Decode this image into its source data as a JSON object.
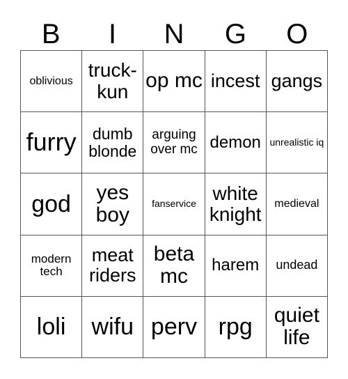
{
  "header": [
    "B",
    "I",
    "N",
    "G",
    "O"
  ],
  "cells": [
    {
      "text": "oblivious",
      "size": 16
    },
    {
      "text": "truck-kun",
      "size": 28
    },
    {
      "text": "op mc",
      "size": 30
    },
    {
      "text": "incest",
      "size": 27
    },
    {
      "text": "gangs",
      "size": 27
    },
    {
      "text": "furry",
      "size": 36
    },
    {
      "text": "dumb blonde",
      "size": 23
    },
    {
      "text": "arguing over mc",
      "size": 19
    },
    {
      "text": "demon",
      "size": 24
    },
    {
      "text": "unrealistic iq",
      "size": 14
    },
    {
      "text": "god",
      "size": 34
    },
    {
      "text": "yes boy",
      "size": 30
    },
    {
      "text": "fanservice",
      "size": 14
    },
    {
      "text": "white knight",
      "size": 28
    },
    {
      "text": "medieval",
      "size": 16
    },
    {
      "text": "modern tech",
      "size": 17
    },
    {
      "text": "meat riders",
      "size": 27
    },
    {
      "text": "beta mc",
      "size": 30
    },
    {
      "text": "harem",
      "size": 24
    },
    {
      "text": "undead",
      "size": 18
    },
    {
      "text": "loli",
      "size": 34
    },
    {
      "text": "wifu",
      "size": 34
    },
    {
      "text": "perv",
      "size": 34
    },
    {
      "text": "rpg",
      "size": 34
    },
    {
      "text": "quiet life",
      "size": 30
    }
  ]
}
